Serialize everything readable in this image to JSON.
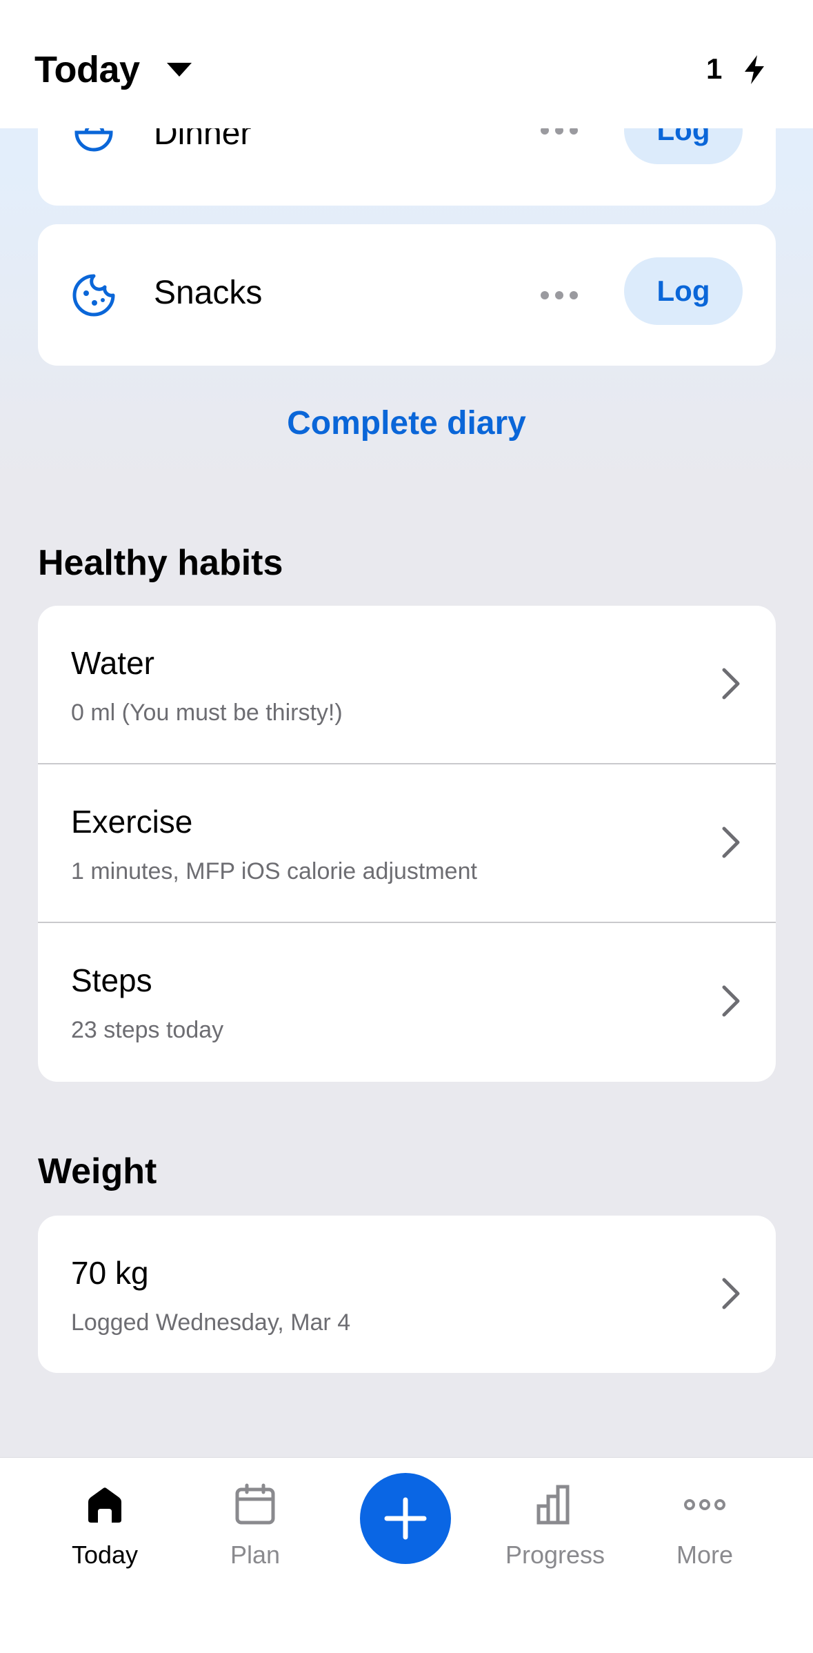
{
  "header": {
    "title": "Today",
    "streak_count": "1"
  },
  "diary": {
    "meals": [
      {
        "label": "Dinner",
        "log_label": "Log",
        "icon": "bowl-icon"
      },
      {
        "label": "Snacks",
        "log_label": "Log",
        "icon": "cookie-icon"
      }
    ],
    "complete_diary_label": "Complete diary"
  },
  "habits": {
    "title": "Healthy habits",
    "items": [
      {
        "title": "Water",
        "subtitle": "0 ml (You must be thirsty!)"
      },
      {
        "title": "Exercise",
        "subtitle": "1 minutes, MFP iOS calorie adjustment"
      },
      {
        "title": "Steps",
        "subtitle": "23 steps today"
      }
    ]
  },
  "weight": {
    "title": "Weight",
    "value": "70 kg",
    "subtitle": "Logged Wednesday, Mar 4"
  },
  "tabbar": {
    "tabs": [
      {
        "label": "Today",
        "icon": "home-icon",
        "active": true
      },
      {
        "label": "Plan",
        "icon": "calendar-icon",
        "active": false
      },
      {
        "label": "Progress",
        "icon": "bar-chart-icon",
        "active": false
      },
      {
        "label": "More",
        "icon": "more-dots-icon",
        "active": false
      }
    ],
    "add_icon": "plus-icon"
  },
  "colors": {
    "accent": "#0a66e4",
    "log_button_bg": "#dcebfb",
    "background": "#e9e9ee"
  }
}
